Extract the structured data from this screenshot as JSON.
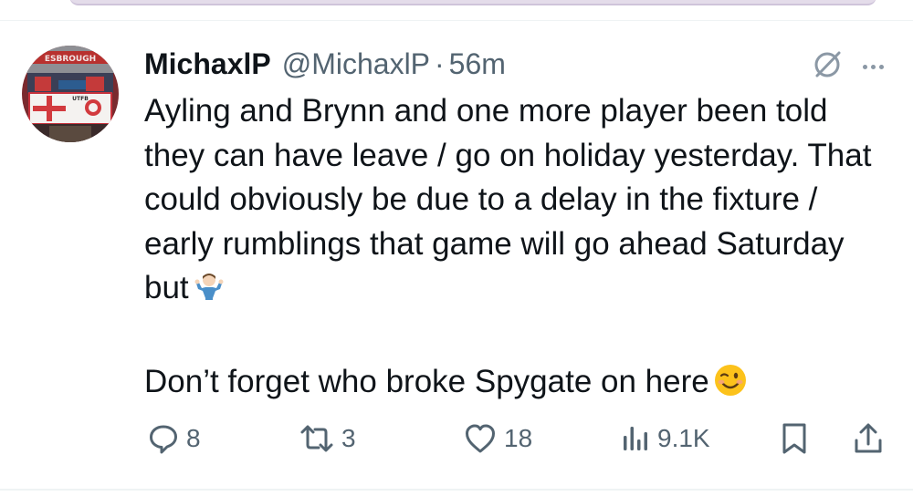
{
  "author": {
    "display_name": "MichaxlP",
    "handle": "@MichaxlP",
    "separator": "·",
    "time": "56m"
  },
  "tweet": {
    "text": "Ayling and Brynn and one more player been told they can have leave / go on holiday yesterday. That could obviously be due to a delay in the fixture / early rumblings that game will go ahead Saturday but",
    "text2": "Don’t forget who broke Spygate on here"
  },
  "avatar": {
    "sign_text": "ESBROUGH",
    "flag_text": "UTFB"
  },
  "icons": {
    "grok": "grok-icon",
    "more": "more-icon",
    "reply": "reply-icon",
    "retweet": "retweet-icon",
    "like": "like-icon",
    "views": "views-icon",
    "bookmark": "bookmark-icon",
    "share": "share-icon"
  },
  "actions": {
    "replies": "8",
    "retweets": "3",
    "likes": "18",
    "views": "9.1K"
  },
  "colors": {
    "text": "#0f1419",
    "secondary": "#536471",
    "icon": "#536471"
  }
}
